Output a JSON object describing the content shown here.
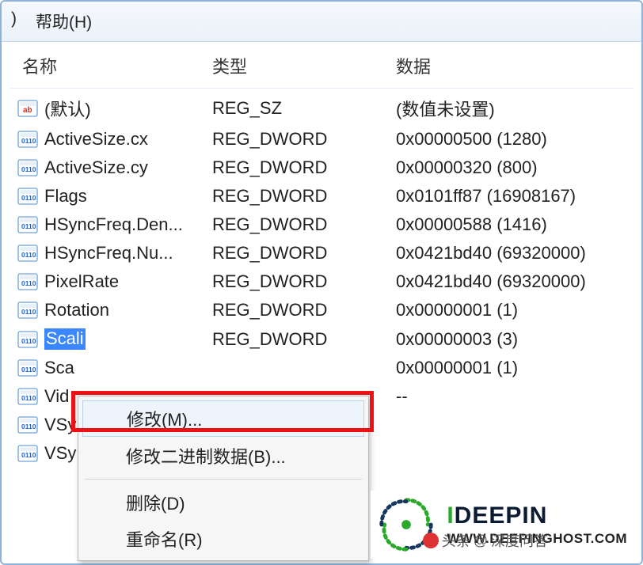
{
  "menu": {
    "trunc": ")",
    "help": "帮助(H)"
  },
  "columns": {
    "name": "名称",
    "type": "类型",
    "data": "数据"
  },
  "rows": [
    {
      "name": "(默认)",
      "type": "REG_SZ",
      "data": "(数值未设置)",
      "icon": "sz",
      "sel": false
    },
    {
      "name": "ActiveSize.cx",
      "type": "REG_DWORD",
      "data": "0x00000500 (1280)",
      "icon": "bin",
      "sel": false
    },
    {
      "name": "ActiveSize.cy",
      "type": "REG_DWORD",
      "data": "0x00000320 (800)",
      "icon": "bin",
      "sel": false
    },
    {
      "name": "Flags",
      "type": "REG_DWORD",
      "data": "0x0101ff87 (16908167)",
      "icon": "bin",
      "sel": false
    },
    {
      "name": "HSyncFreq.Den...",
      "type": "REG_DWORD",
      "data": "0x00000588 (1416)",
      "icon": "bin",
      "sel": false
    },
    {
      "name": "HSyncFreq.Nu...",
      "type": "REG_DWORD",
      "data": "0x0421bd40 (69320000)",
      "icon": "bin",
      "sel": false
    },
    {
      "name": "PixelRate",
      "type": "REG_DWORD",
      "data": "0x0421bd40 (69320000)",
      "icon": "bin",
      "sel": false
    },
    {
      "name": "Rotation",
      "type": "REG_DWORD",
      "data": "0x00000001 (1)",
      "icon": "bin",
      "sel": false
    },
    {
      "name": "Scali",
      "type": "REG_DWORD",
      "data": "0x00000003 (3)",
      "icon": "bin",
      "sel": true
    },
    {
      "name": "Sca",
      "type": "",
      "data": "0x00000001 (1)",
      "icon": "bin",
      "sel": false
    },
    {
      "name": "Vid",
      "type": "",
      "data": "--",
      "icon": "bin",
      "sel": false
    },
    {
      "name": "VSy",
      "type": "",
      "data": "",
      "icon": "bin",
      "sel": false
    },
    {
      "name": "VSy",
      "type": "",
      "data": "",
      "icon": "bin",
      "sel": false
    }
  ],
  "context_menu": {
    "modify": "修改(M)...",
    "modify_binary": "修改二进制数据(B)...",
    "delete": "删除(D)",
    "rename": "重命名(R)"
  },
  "watermark": {
    "brand_i": "I",
    "brand_rest": "DEEPIN",
    "url": "WWW.DEEPINGHOST.COM"
  },
  "byline": {
    "prefix": "头条",
    "at": "@",
    "name": "深度问答"
  }
}
